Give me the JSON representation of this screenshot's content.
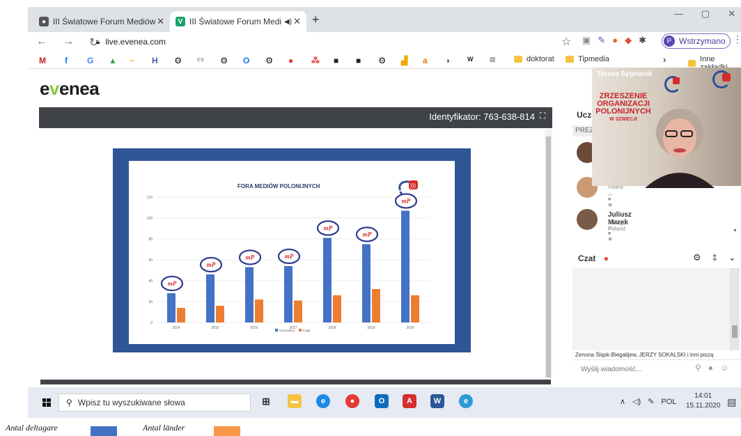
{
  "browser": {
    "tabs": [
      {
        "title": "III Światowe Forum Mediów Polo",
        "close": "✕"
      },
      {
        "title": "III Światowe Forum Mediów I",
        "close": "✕"
      }
    ],
    "new_tab": "+",
    "window_controls": [
      "—",
      "▢",
      "✕"
    ],
    "url": "live.evenea.com",
    "profile_initial": "P",
    "profile_label": "Wstrzymano",
    "bookmark_folders": [
      "doktorat",
      "Tipmedia",
      "Inne zakładki"
    ]
  },
  "page": {
    "logo_prefix": "e",
    "logo_accent": "v",
    "logo_suffix": "enea",
    "identifier": "Identyfikator: 763-638-814"
  },
  "slide": {
    "chart_data": {
      "type": "bar",
      "title": "FORA MEDIÓW POLONIJNYCH",
      "categories": [
        "2014",
        "2015",
        "2016",
        "2017",
        "2018",
        "2019",
        "2020"
      ],
      "ylim": [
        0,
        120
      ],
      "yticks": [
        0,
        20,
        40,
        60,
        80,
        100,
        120
      ],
      "series": [
        {
          "name": "Uczestnicy",
          "color": "#4472c4",
          "values": [
            28,
            46,
            53,
            54,
            81,
            75,
            107
          ]
        },
        {
          "name": "Kraje",
          "color": "#ed7d31",
          "values": [
            14,
            16,
            22,
            21,
            26,
            32,
            26
          ]
        }
      ],
      "badge_text": "mP"
    }
  },
  "panel": {
    "participants_title": "Ucze",
    "prez_label": "PREZE",
    "video_name": "Teresa Sygnarek",
    "poster_lines": [
      "ZRZESZENIE",
      "ORGANIZACJI",
      "POLONIJNYCH",
      "W SZWECJI"
    ],
    "participants": [
      {
        "name": "",
        "location": ""
      },
      {
        "name": "",
        "location": "Poland"
      },
      {
        "name": "Juliusz Marek",
        "location": "Elbląg, Poland"
      }
    ],
    "chat_title": "Czat",
    "typing_text": "Zenona Śląsk-Biegalijew, JERZY SOKALSKI i inni piszą",
    "chat_placeholder": "Wyślij wiadomość..."
  },
  "taskbar": {
    "search_placeholder": "Wpisz tu wyszukiwane słowa",
    "lang": "POL",
    "time": "14:01",
    "date": "15.11.2020"
  },
  "legend_below": [
    {
      "label": "Antal deltagare",
      "color": "#4472c4"
    },
    {
      "label": "Antal länder",
      "color": "#f79646"
    }
  ]
}
